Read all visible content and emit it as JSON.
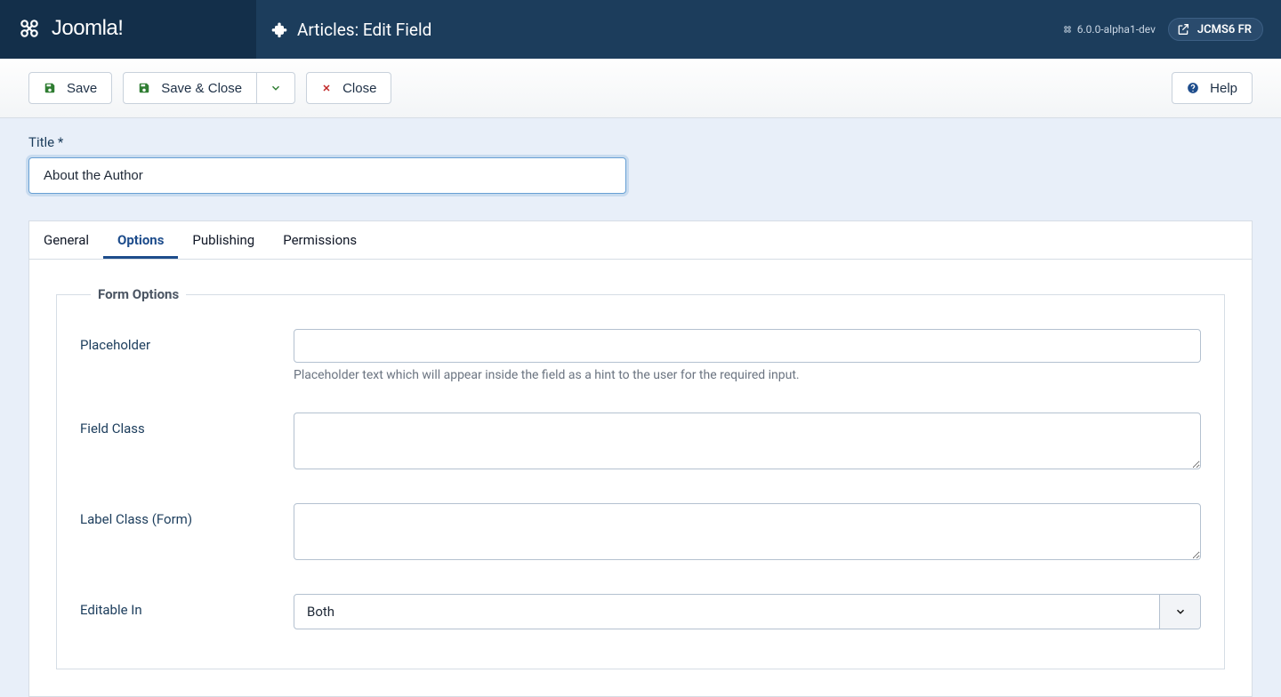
{
  "header": {
    "brand": "Joomla!",
    "page_title": "Articles: Edit Field",
    "version": "6.0.0-alpha1-dev",
    "site_name": "JCMS6 FR"
  },
  "toolbar": {
    "save": "Save",
    "save_close": "Save & Close",
    "close": "Close",
    "help": "Help"
  },
  "main": {
    "title_label": "Title *",
    "title_value": "About the Author"
  },
  "tabs": {
    "general": "General",
    "options": "Options",
    "publishing": "Publishing",
    "permissions": "Permissions",
    "active": "options"
  },
  "form_options": {
    "legend": "Form Options",
    "placeholder": {
      "label": "Placeholder",
      "value": "",
      "desc": "Placeholder text which will appear inside the field as a hint to the user for the required input."
    },
    "field_class": {
      "label": "Field Class",
      "value": ""
    },
    "label_class_form": {
      "label": "Label Class (Form)",
      "value": ""
    },
    "editable_in": {
      "label": "Editable In",
      "selected": "Both"
    }
  },
  "colors": {
    "green": "#2f7d32",
    "red": "#c02626",
    "blue": "#1e4d8c"
  }
}
